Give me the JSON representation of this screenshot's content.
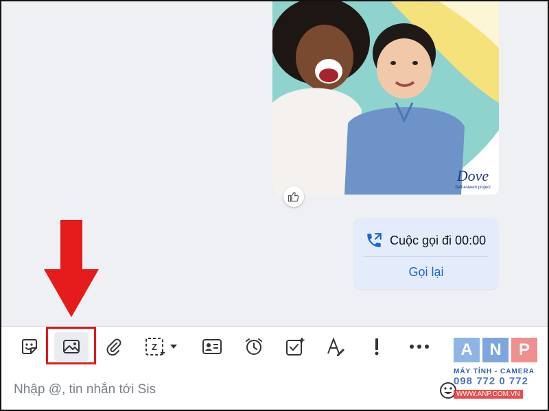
{
  "call_bubble": {
    "text": "Cuộc gọi đi 00:00",
    "callback_label": "Gọi lại"
  },
  "photo": {
    "brand": "Dove",
    "brand_tagline": "Self-esteem project"
  },
  "toolbar": {
    "items": [
      "sticker-icon",
      "image-icon",
      "attachment-icon",
      "screenshot-icon",
      "contact-card-icon",
      "reminder-icon",
      "task-icon",
      "format-text-icon",
      "urgent-icon",
      "more-icon"
    ]
  },
  "composer": {
    "placeholder": "Nhập @, tin nhắn tới Sis"
  },
  "watermark": {
    "letters": [
      "A",
      "N",
      "P"
    ],
    "tagline": "MÁY TÍNH - CAMERA",
    "phone": "098 772 0 772",
    "website": "WWW.ANP.COM.VN"
  },
  "colors": {
    "accent": "#1967d2",
    "highlight": "#e11b1b",
    "bubble": "#e4ecfb"
  }
}
